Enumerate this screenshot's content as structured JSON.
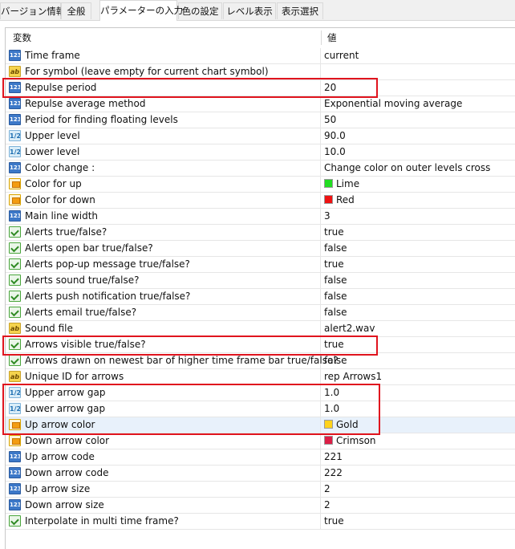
{
  "tabs": [
    {
      "label": "バージョン情報",
      "active": false
    },
    {
      "label": "全般",
      "active": false
    },
    {
      "label": "パラメーターの入力",
      "active": true
    },
    {
      "label": "色の設定",
      "active": false
    },
    {
      "label": "レベル表示",
      "active": false
    },
    {
      "label": "表示選択",
      "active": false
    }
  ],
  "table": {
    "col_variable": "変数",
    "col_value": "値",
    "rows": [
      {
        "type": "int",
        "icon": "123",
        "name": "Time frame",
        "value": "current"
      },
      {
        "type": "str",
        "icon": "ab",
        "name": "For symbol (leave empty for current chart symbol)",
        "value": ""
      },
      {
        "type": "int",
        "icon": "123",
        "name": "Repulse period",
        "value": "20"
      },
      {
        "type": "int",
        "icon": "123",
        "name": "Repulse average method",
        "value": "Exponential moving average"
      },
      {
        "type": "int",
        "icon": "123",
        "name": "Period for finding floating levels",
        "value": "50"
      },
      {
        "type": "dbl",
        "icon": "1/2",
        "name": "Upper level",
        "value": "90.0"
      },
      {
        "type": "dbl",
        "icon": "1/2",
        "name": "Lower level",
        "value": "10.0"
      },
      {
        "type": "int",
        "icon": "123",
        "name": "Color change :",
        "value": "Change color on outer levels cross"
      },
      {
        "type": "clr",
        "icon": "color-icon",
        "name": "Color for up",
        "value": "Lime",
        "color": "#22dd22"
      },
      {
        "type": "clr",
        "icon": "color-icon",
        "name": "Color for down",
        "value": "Red",
        "color": "#ee1111"
      },
      {
        "type": "int",
        "icon": "123",
        "name": "Main line width",
        "value": "3"
      },
      {
        "type": "bool",
        "icon": "check-icon",
        "name": "Alerts true/false?",
        "value": "true"
      },
      {
        "type": "bool",
        "icon": "check-icon",
        "name": "Alerts open bar true/false?",
        "value": "false"
      },
      {
        "type": "bool",
        "icon": "check-icon",
        "name": "Alerts pop-up message true/false?",
        "value": "true"
      },
      {
        "type": "bool",
        "icon": "check-icon",
        "name": "Alerts sound true/false?",
        "value": "false"
      },
      {
        "type": "bool",
        "icon": "check-icon",
        "name": "Alerts push notification true/false?",
        "value": "false"
      },
      {
        "type": "bool",
        "icon": "check-icon",
        "name": "Alerts email true/false?",
        "value": "false"
      },
      {
        "type": "str",
        "icon": "ab",
        "name": "Sound file",
        "value": "alert2.wav"
      },
      {
        "type": "bool",
        "icon": "check-icon",
        "name": "Arrows visible true/false?",
        "value": "true"
      },
      {
        "type": "bool",
        "icon": "check-icon",
        "name": "Arrows drawn on newest bar of higher time frame bar true/false?",
        "value": "false"
      },
      {
        "type": "str",
        "icon": "ab",
        "name": "Unique ID for arrows",
        "value": "rep Arrows1"
      },
      {
        "type": "dbl",
        "icon": "1/2",
        "name": "Upper arrow gap",
        "value": "1.0"
      },
      {
        "type": "dbl",
        "icon": "1/2",
        "name": "Lower arrow gap",
        "value": "1.0"
      },
      {
        "type": "clr",
        "icon": "color-icon",
        "name": "Up arrow color",
        "value": "Gold",
        "color": "#ffd21a",
        "selected": true
      },
      {
        "type": "clr",
        "icon": "color-icon",
        "name": "Down arrow color",
        "value": "Crimson",
        "color": "#dc1e46"
      },
      {
        "type": "int",
        "icon": "123",
        "name": "Up arrow code",
        "value": "221"
      },
      {
        "type": "int",
        "icon": "123",
        "name": "Down arrow code",
        "value": "222"
      },
      {
        "type": "int",
        "icon": "123",
        "name": "Up arrow size",
        "value": "2"
      },
      {
        "type": "int",
        "icon": "123",
        "name": "Down arrow size",
        "value": "2"
      },
      {
        "type": "bool",
        "icon": "check-icon",
        "name": "Interpolate in multi time frame?",
        "value": "true"
      }
    ]
  },
  "highlight_color": "#e0141e"
}
